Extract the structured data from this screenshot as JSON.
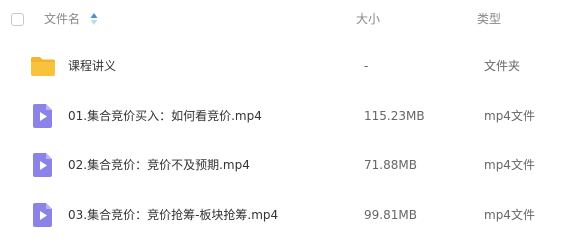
{
  "header": {
    "name_label": "文件名",
    "size_label": "大小",
    "type_label": "类型"
  },
  "colors": {
    "folder": "#f9c23c",
    "video": "#8c83e8",
    "header_text": "#888888",
    "sort_active": "#4a90e2"
  },
  "files": [
    {
      "name": "课程讲义",
      "size": "-",
      "type": "文件夹",
      "icon": "folder-icon"
    },
    {
      "name": "01.集合竞价买入：如何看竞价.mp4",
      "size": "115.23MB",
      "type": "mp4文件",
      "icon": "video-file-icon"
    },
    {
      "name": "02.集合竞价：竞价不及预期.mp4",
      "size": "71.88MB",
      "type": "mp4文件",
      "icon": "video-file-icon"
    },
    {
      "name": "03.集合竞价：竞价抢筹-板块抢筹.mp4",
      "size": "99.81MB",
      "type": "mp4文件",
      "icon": "video-file-icon"
    }
  ]
}
